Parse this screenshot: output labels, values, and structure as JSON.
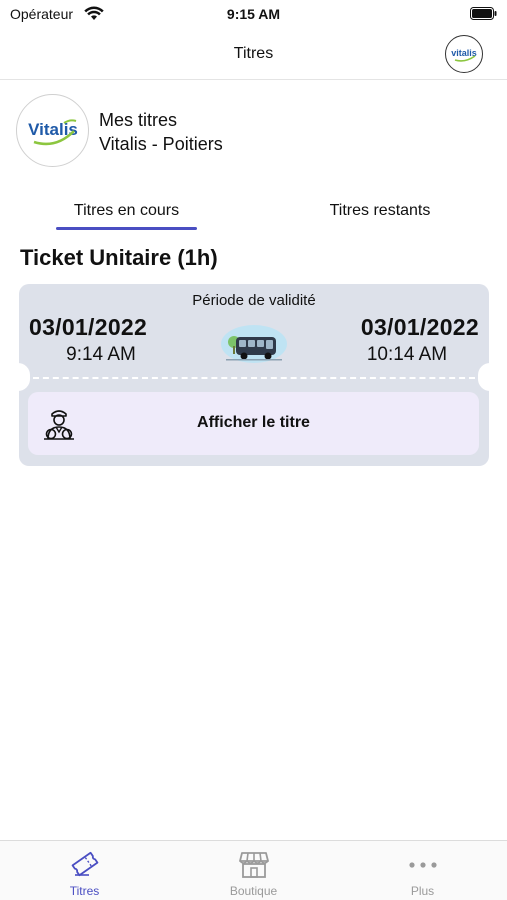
{
  "status_bar": {
    "carrier": "Opérateur",
    "time": "9:15 AM"
  },
  "nav": {
    "title": "Titres",
    "logo_icon": "vitalis-logo-icon"
  },
  "header": {
    "line1": "Mes titres",
    "line2": "Vitalis - Poitiers",
    "logo_text": "Vitalis"
  },
  "tabs": [
    {
      "label": "Titres en cours",
      "active": true
    },
    {
      "label": "Titres restants",
      "active": false
    }
  ],
  "ticket": {
    "name": "Ticket Unitaire (1h)",
    "validity_label": "Période de validité",
    "start_date": "03/01/2022",
    "start_time": "9:14 AM",
    "end_date": "03/01/2022",
    "end_time": "10:14 AM",
    "illustration_icon": "bus-icon",
    "show_button_label": "Afficher le titre",
    "show_button_icon": "driver-icon"
  },
  "tab_bar": [
    {
      "label": "Titres",
      "icon": "ticket-icon",
      "active": true
    },
    {
      "label": "Boutique",
      "icon": "shop-icon",
      "active": false
    },
    {
      "label": "Plus",
      "icon": "more-dots-icon",
      "active": false
    }
  ],
  "colors": {
    "accent": "#4a4ec2",
    "card_background": "#dde1ea",
    "button_background": "#efebfa",
    "brand_blue": "#1f5aa8",
    "brand_green": "#8cc63f"
  }
}
